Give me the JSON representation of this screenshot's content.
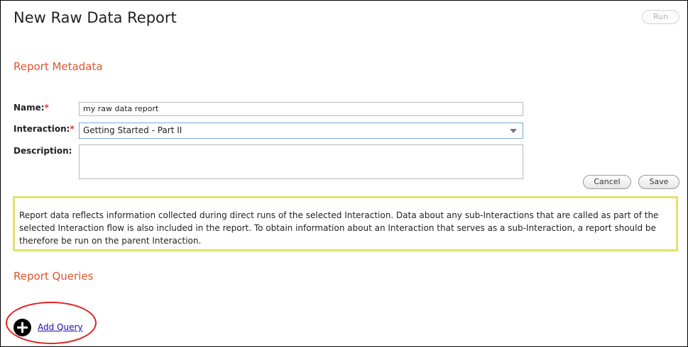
{
  "page": {
    "title": "New Raw Data Report"
  },
  "toolbar": {
    "run_label": "Run"
  },
  "metadata": {
    "section_title": "Report Metadata",
    "name": {
      "label": "Name:",
      "required": "*",
      "value": "my raw data report"
    },
    "interaction": {
      "label": "Interaction:",
      "required": "*",
      "value": "Getting Started - Part II"
    },
    "description": {
      "label": "Description:",
      "value": ""
    },
    "cancel_label": "Cancel",
    "save_label": "Save"
  },
  "info": {
    "text": "Report data reflects information collected during direct runs of the selected Interaction. Data about any sub-Interactions that are called as part of the selected Interaction flow is also included in the report. To obtain information about an Interaction that serves as a sub-Interaction, a report should be therefore be run on the parent Interaction."
  },
  "queries": {
    "section_title": "Report Queries",
    "add_query_label": "Add Query"
  },
  "colors": {
    "accent": "#e0542b",
    "required": "#e0312b",
    "info_border": "#e2e26c",
    "link": "#1a0dab",
    "highlight": "#e02020"
  }
}
